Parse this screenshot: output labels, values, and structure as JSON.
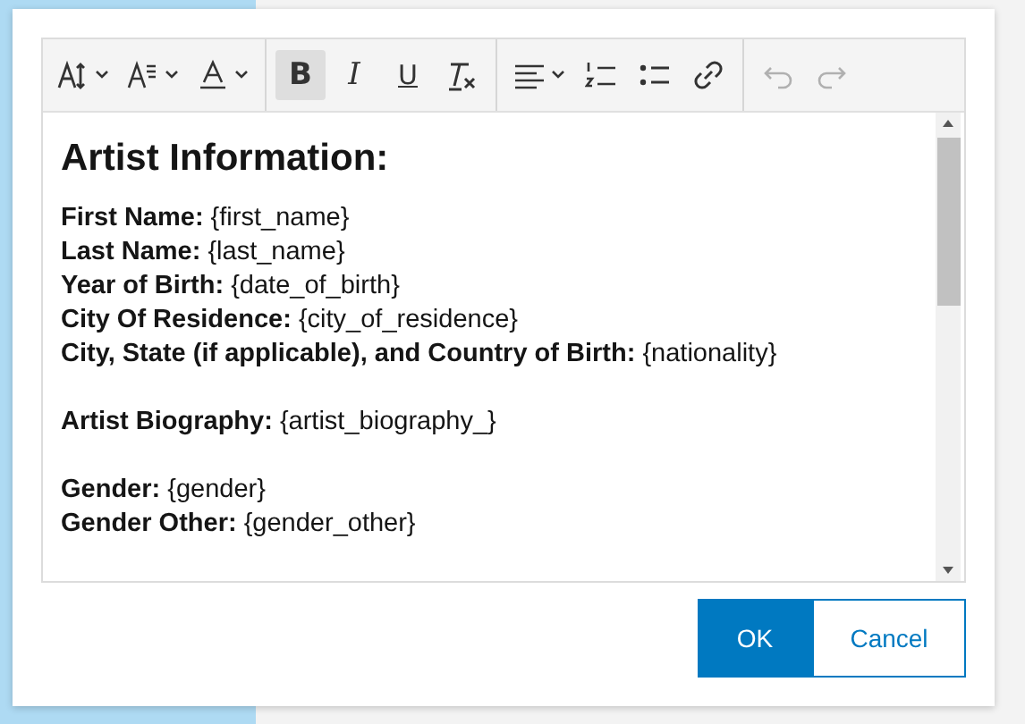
{
  "toolbar": {
    "groups": [
      [
        {
          "kind": "font-size",
          "dropdown": true,
          "selected": false,
          "disabled": false
        },
        {
          "kind": "text-format",
          "dropdown": true,
          "selected": false,
          "disabled": false
        },
        {
          "kind": "font-color",
          "dropdown": true,
          "selected": false,
          "disabled": false
        }
      ],
      [
        {
          "kind": "bold",
          "glyph": "B",
          "selected": true,
          "disabled": false
        },
        {
          "kind": "italic",
          "glyph": "I",
          "selected": false,
          "disabled": false
        },
        {
          "kind": "underline",
          "glyph": "U",
          "selected": false,
          "disabled": false
        },
        {
          "kind": "clear-format",
          "selected": false,
          "disabled": false
        }
      ],
      [
        {
          "kind": "align",
          "dropdown": true,
          "selected": false,
          "disabled": false
        },
        {
          "kind": "numbered-list",
          "selected": false,
          "disabled": false
        },
        {
          "kind": "bullet-list",
          "selected": false,
          "disabled": false
        },
        {
          "kind": "link",
          "selected": false,
          "disabled": false
        }
      ],
      [
        {
          "kind": "undo",
          "disabled": true
        },
        {
          "kind": "redo",
          "disabled": true
        }
      ]
    ]
  },
  "content": {
    "heading": "Artist Information:",
    "paragraphs": [
      [
        "**First Name:** {first_name}",
        "**Last Name:** {last_name}",
        "**Year of Birth:** {date_of_birth}",
        "**City Of Residence:** {city_of_residence}",
        "**City, State (if applicable), and Country of Birth:** {nationality}"
      ],
      [
        "**Artist Biography:** {artist_biography_}"
      ],
      [
        "**Gender:** {gender}",
        "**Gender Other:** {gender_other}"
      ]
    ]
  },
  "buttons": [
    {
      "label": "OK",
      "primary": true
    },
    {
      "label": "Cancel",
      "primary": false
    }
  ]
}
